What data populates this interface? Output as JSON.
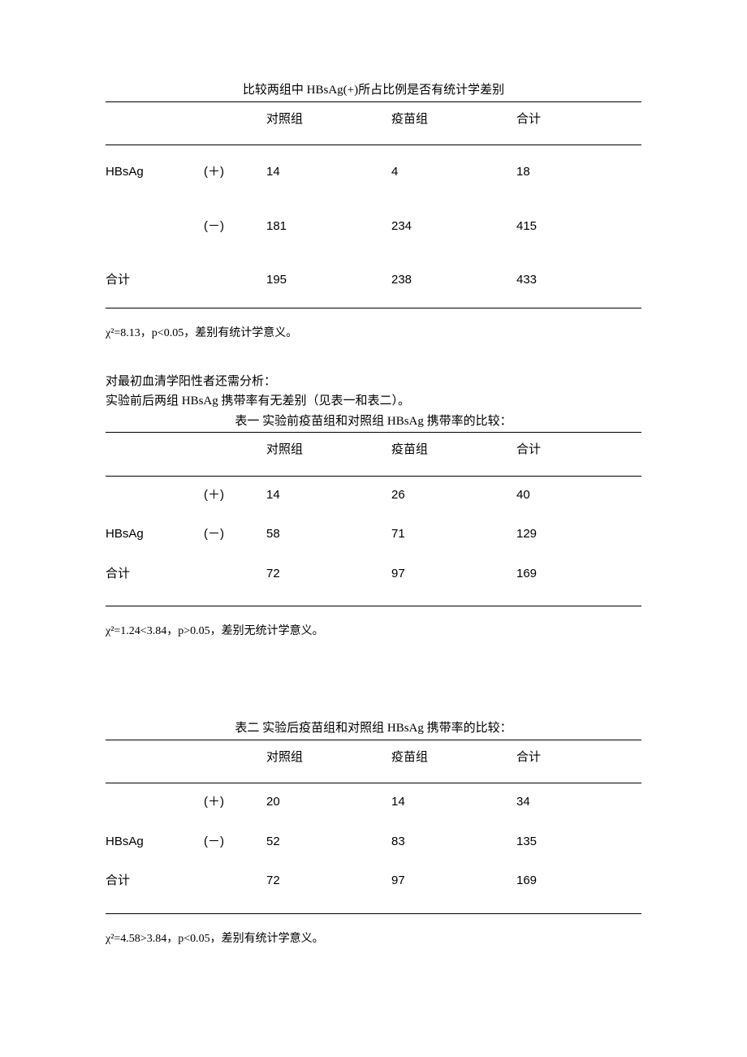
{
  "table1": {
    "caption": "比较两组中 HBsAg(+)所占比例是否有统计学差别",
    "headers": {
      "c1": "对照组",
      "c2": "疫苗组",
      "c3": "合计"
    },
    "rowLabel": "HBsAg",
    "signs": {
      "pos": "(＋)",
      "neg": "(－)"
    },
    "rows": {
      "pos": {
        "v1": "14",
        "v2": "4",
        "v3": "18"
      },
      "neg": {
        "v1": "181",
        "v2": "234",
        "v3": "415"
      },
      "total": {
        "label": "合计",
        "v1": "195",
        "v2": "238",
        "v3": "433"
      }
    },
    "note": "χ²=8.13，p<0.05，差别有统计学意义。"
  },
  "paras": {
    "p1": "对最初血清学阳性者还需分析：",
    "p2": "实验前后两组 HBsAg 携带率有无差别（见表一和表二）。"
  },
  "table2": {
    "caption": "表一  实验前疫苗组和对照组 HBsAg     携带率的比较：",
    "headers": {
      "c1": "对照组",
      "c2": "疫苗组",
      "c3": "合计"
    },
    "rowLabel": "HBsAg",
    "signs": {
      "pos": "(＋)",
      "neg": "(－)"
    },
    "rows": {
      "pos": {
        "v1": "14",
        "v2": "26",
        "v3": "40"
      },
      "neg": {
        "v1": "58",
        "v2": "71",
        "v3": "129"
      },
      "total": {
        "label": "合计",
        "v1": "72",
        "v2": "97",
        "v3": "169"
      }
    },
    "note": "χ²=1.24<3.84，p>0.05，差别无统计学意义。"
  },
  "table3": {
    "caption": "表二  实验后疫苗组和对照组 HBsAg 携带率的比较：",
    "headers": {
      "c1": "对照组",
      "c2": "疫苗组",
      "c3": "合计"
    },
    "rowLabel": "HBsAg",
    "signs": {
      "pos": "(＋)",
      "neg": "(－)"
    },
    "rows": {
      "pos": {
        "v1": "20",
        "v2": "14",
        "v3": "34"
      },
      "neg": {
        "v1": "52",
        "v2": "83",
        "v3": "135"
      },
      "total": {
        "label": "合计",
        "v1": "72",
        "v2": "97",
        "v3": "169"
      }
    },
    "note": "χ²=4.58>3.84，p<0.05，差别有统计学意义。"
  }
}
